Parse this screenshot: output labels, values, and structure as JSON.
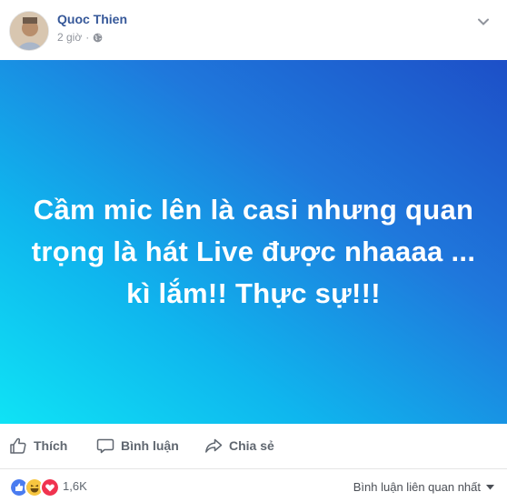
{
  "post": {
    "author": "Quoc Thien",
    "time": "2 giờ",
    "separator": "·",
    "banner_text": "Cầm mic lên là casi nhưng quan trọng là hát Live được nhaaaa ... kì lắm!! Thực sự!!!"
  },
  "actions": {
    "like": "Thích",
    "comment": "Bình luận",
    "share": "Chia sẻ"
  },
  "reactions": {
    "count": "1,6K",
    "icons": [
      "like-icon",
      "haha-icon",
      "love-icon"
    ],
    "sort_label": "Bình luận liên quan nhất"
  },
  "colors": {
    "link_blue": "#365899",
    "like_blue": "#4a7cf0",
    "haha_yellow": "#f7c640",
    "love_red": "#f0334f",
    "banner_top": "#1d4fc7",
    "banner_bottom": "#0fe3f5"
  }
}
